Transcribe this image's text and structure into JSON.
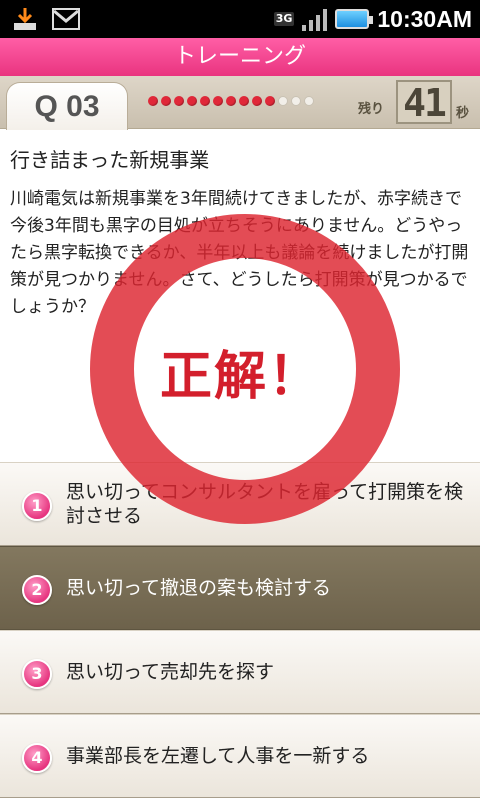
{
  "status_bar": {
    "clock": "10:30AM",
    "network": "3G",
    "icons": [
      "download-icon",
      "gmail-icon",
      "signal-icon",
      "battery-icon"
    ]
  },
  "title": "トレーニング",
  "question": {
    "number": "Q 03",
    "dots_total": 13,
    "dots_done": 10,
    "remaining_label": "残り",
    "remaining_seconds": "41",
    "seconds_unit": "秒",
    "title": "行き詰まった新規事業",
    "body": "川崎電気は新規事業を3年間続けてきましたが、赤字続きで今後3年間も黒字の目処が立ちそうにありません。どうやったら黒字転換できるか、半年以上も議論を続けましたが打開策が見つかりません。さて、どうしたら打開策が見つかるでしょうか？"
  },
  "result_text": "正解！",
  "answers": [
    {
      "num": "1",
      "text": "思い切ってコンサルタントを雇って打開策を検討させる"
    },
    {
      "num": "2",
      "text": "思い切って撤退の案も検討する"
    },
    {
      "num": "3",
      "text": "思い切って売却先を探す"
    },
    {
      "num": "4",
      "text": "事業部長を左遷して人事を一新する"
    }
  ],
  "colors": {
    "accent": "#e9347f",
    "correct_red": "#dd2430",
    "selected_bg": "#766b53"
  }
}
